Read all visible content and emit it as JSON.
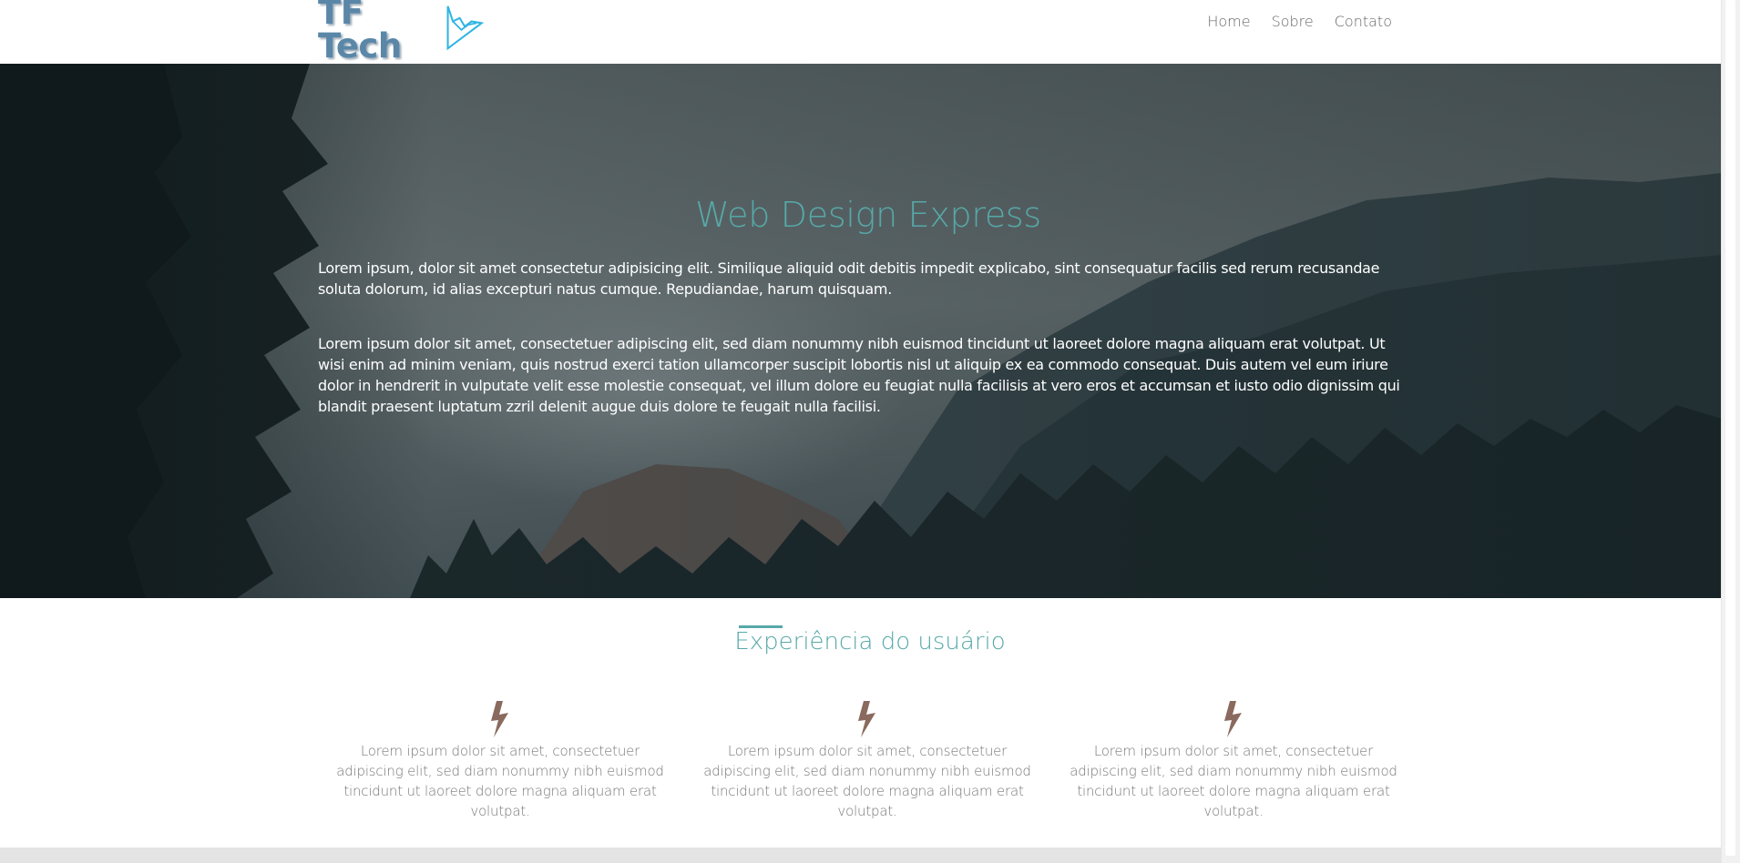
{
  "header": {
    "logo_text": "TF Tech",
    "nav": [
      {
        "label": "Home"
      },
      {
        "label": "Sobre"
      },
      {
        "label": "Contato"
      }
    ]
  },
  "hero": {
    "title": "Web Design Express",
    "paragraph_1": "Lorem ipsum, dolor sit amet consectetur adipisicing elit. Similique aliquid odit debitis impedit explicabo, sint consequatur facilis sed rerum recusandae soluta dolorum, id alias excepturi natus cumque. Repudiandae, harum quisquam.",
    "paragraph_2": "Lorem ipsum dolor sit amet, consectetuer adipiscing elit, sed diam nonummy nibh euismod tincidunt ut laoreet dolore magna aliquam erat volutpat. Ut wisi enim ad minim veniam, quis nostrud exerci tation ullamcorper suscipit lobortis nisl ut aliquip ex ea commodo consequat. Duis autem vel eum iriure dolor in hendrerit in vulputate velit esse molestie consequat, vel illum dolore eu feugiat nulla facilisis at vero eros et accumsan et iusto odio dignissim qui blandit praesent luptatum zzril delenit augue duis dolore te feugait nulla facilisi."
  },
  "features": {
    "title": "Experiência do usuário",
    "items": [
      {
        "icon": "lightning-bolt-icon",
        "text": "Lorem ipsum dolor sit amet, consectetuer adipiscing elit, sed diam nonummy nibh euismod tincidunt ut laoreet dolore magna aliquam erat volutpat."
      },
      {
        "icon": "lightning-bolt-icon",
        "text": "Lorem ipsum dolor sit amet, consectetuer adipiscing elit, sed diam nonummy nibh euismod tincidunt ut laoreet dolore magna aliquam erat volutpat."
      },
      {
        "icon": "lightning-bolt-icon",
        "text": "Lorem ipsum dolor sit amet, consectetuer adipiscing elit, sed diam nonummy nibh euismod tincidunt ut laoreet dolore magna aliquam erat volutpat."
      }
    ]
  },
  "colors": {
    "accent": "#57a8a8",
    "logo": "#5a87a8",
    "icon": "#8a6a5e",
    "nav_text": "#666666"
  }
}
